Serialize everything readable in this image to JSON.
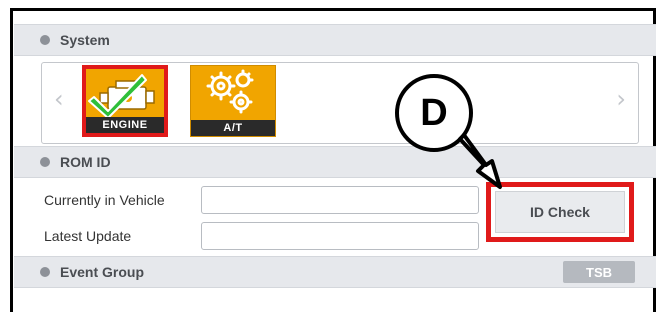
{
  "system": {
    "title": "System"
  },
  "tiles": [
    {
      "name": "ENGINE",
      "selected": true
    },
    {
      "name": "A/T",
      "selected": false
    }
  ],
  "rom_id": {
    "title": "ROM ID",
    "currently_label": "Currently in Vehicle",
    "currently_value": "",
    "latest_label": "Latest Update",
    "latest_value": "",
    "id_check_label": "ID Check"
  },
  "event_group": {
    "title": "Event Group",
    "tsb_label": "TSB"
  },
  "callout": {
    "letter": "D"
  },
  "colors": {
    "highlight": "#e01a1a",
    "tile": "#f1a500",
    "header_bg": "#e6e8ec"
  },
  "icons": {
    "engine": "engine-check-icon",
    "at": "gears-icon"
  }
}
